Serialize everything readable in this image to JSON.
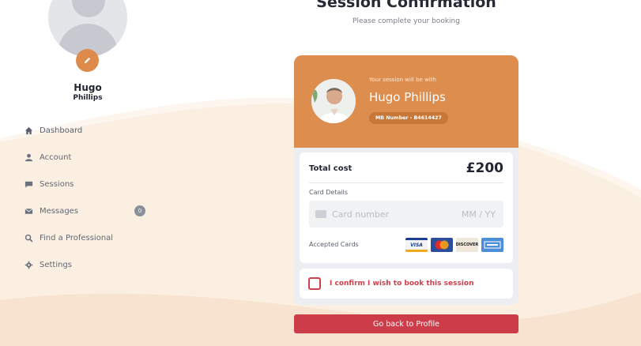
{
  "colors": {
    "accent": "#dd8d4e",
    "danger": "#cc3d49",
    "background": "#fdf6ef"
  },
  "profile": {
    "first_name": "Hugo",
    "last_name": "Phillips",
    "edit_icon": "pencil-icon"
  },
  "sidebar": {
    "items": [
      {
        "label": "Dashboard",
        "icon": "home-icon"
      },
      {
        "label": "Account",
        "icon": "user-icon"
      },
      {
        "label": "Sessions",
        "icon": "chat-icon"
      },
      {
        "label": "Messages",
        "icon": "mail-icon",
        "badge": "0"
      },
      {
        "label": "Find a Professional",
        "icon": "search-icon"
      },
      {
        "label": "Settings",
        "icon": "gear-icon"
      }
    ]
  },
  "page": {
    "title": "Session Confirmation",
    "subtitle": "Please complete your booking"
  },
  "booking": {
    "with_text": "Your session will be with",
    "professional_name": "Hugo Phillips",
    "mb_number": "MB Number - B4614427",
    "total_label": "Total cost",
    "total_value": "£200",
    "card_details_label": "Card Details",
    "card_number_placeholder": "Card number",
    "expiry_placeholder": "MM / YY",
    "accepted_cards_label": "Accepted Cards",
    "accepted_cards": [
      "VISA",
      "MasterCard",
      "DISCOVER",
      "AMERICAN EXPRESS"
    ],
    "confirm_label": "I confirm I wish to book this session"
  },
  "actions": {
    "back_label": "Go back to Profile"
  }
}
